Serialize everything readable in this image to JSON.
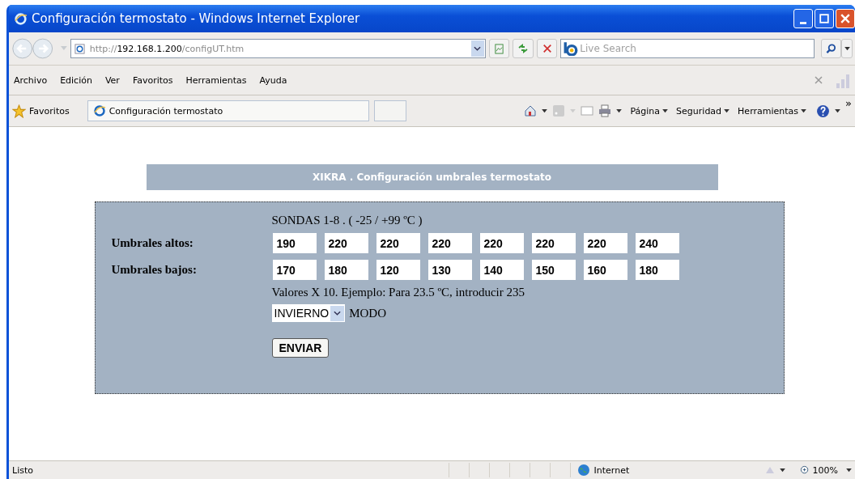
{
  "window": {
    "title": "Configuración termostato - Windows Internet Explorer"
  },
  "address_bar": {
    "url_prefix": "http://",
    "url_host": "192.168.1.200",
    "url_path": "/configUT.htm"
  },
  "search": {
    "placeholder": "Live Search"
  },
  "menu": [
    "Archivo",
    "Edición",
    "Ver",
    "Favoritos",
    "Herramientas",
    "Ayuda"
  ],
  "favorites_bar": {
    "favorites": "Favoritos",
    "tab": "Configuración termostato",
    "commands": [
      "Página",
      "Seguridad",
      "Herramientas"
    ],
    "overflow": "»"
  },
  "page": {
    "header": "XIKRA . Configuración umbrales termostato",
    "probes_label": "SONDAS 1-8 . ( -25 / +99 ºC )",
    "rows": [
      {
        "label": "Umbrales altos:",
        "values": [
          "190",
          "220",
          "220",
          "220",
          "220",
          "220",
          "220",
          "240"
        ]
      },
      {
        "label": "Umbrales bajos:",
        "values": [
          "170",
          "180",
          "120",
          "130",
          "140",
          "150",
          "160",
          "180"
        ]
      }
    ],
    "hint": "Valores X 10. Ejemplo: Para 23.5 ºC, introducir 235",
    "mode_value": "INVIERNO",
    "mode_label": "MODO",
    "submit": "ENVIAR"
  },
  "status_bar": {
    "text": "Listo",
    "zone": "Internet",
    "zoom": "100%"
  }
}
